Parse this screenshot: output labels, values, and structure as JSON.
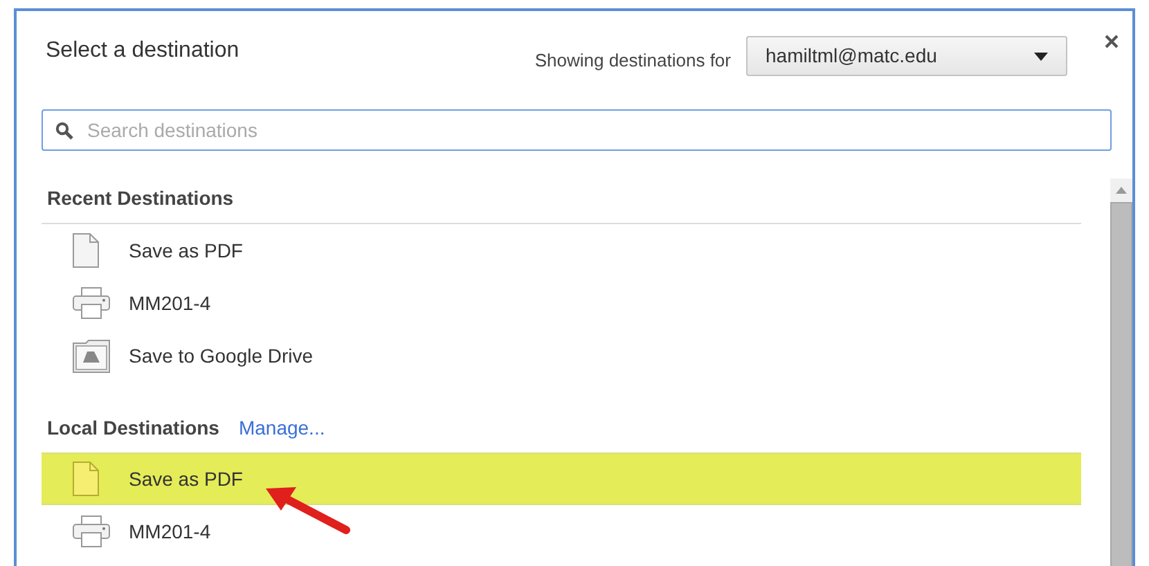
{
  "dialog": {
    "title": "Select a destination",
    "account_label": "Showing destinations for",
    "account": "hamiltml@matc.edu"
  },
  "search": {
    "placeholder": "Search destinations"
  },
  "sections": [
    {
      "title": "Recent Destinations",
      "items": [
        {
          "kind": "document",
          "label": "Save as PDF",
          "selected": false
        },
        {
          "kind": "printer",
          "label": "MM201-4",
          "selected": false
        },
        {
          "kind": "drive",
          "label": "Save to Google Drive",
          "selected": false
        }
      ]
    },
    {
      "title": "Local Destinations",
      "link": "Manage...",
      "items": [
        {
          "kind": "document",
          "label": "Save as PDF",
          "selected": true
        },
        {
          "kind": "printer",
          "label": "MM201-4",
          "selected": false
        }
      ]
    }
  ]
}
